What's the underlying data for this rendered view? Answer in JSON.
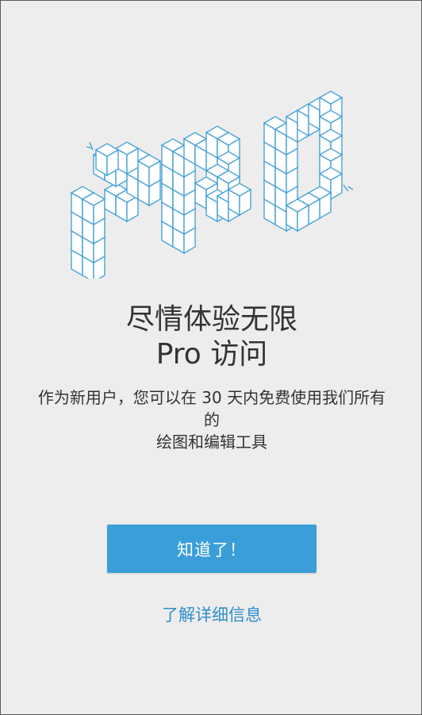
{
  "onboarding": {
    "title_line1": "尽情体验无限",
    "title_line2": "Pro 访问",
    "description_line1": "作为新用户，您可以在 30 天内免费使用我们所有",
    "description_line2": "的",
    "description_line3": "绘图和编辑工具",
    "primary_button_label": "知道了！",
    "learn_more_label": "了解详细信息"
  },
  "colors": {
    "background": "#ededed",
    "accent": "#3a9fd8",
    "link": "#2f8fcb",
    "illustration_stroke": "#4aa3d8"
  },
  "illustration": {
    "icon": "pro-cubes-illustration"
  }
}
